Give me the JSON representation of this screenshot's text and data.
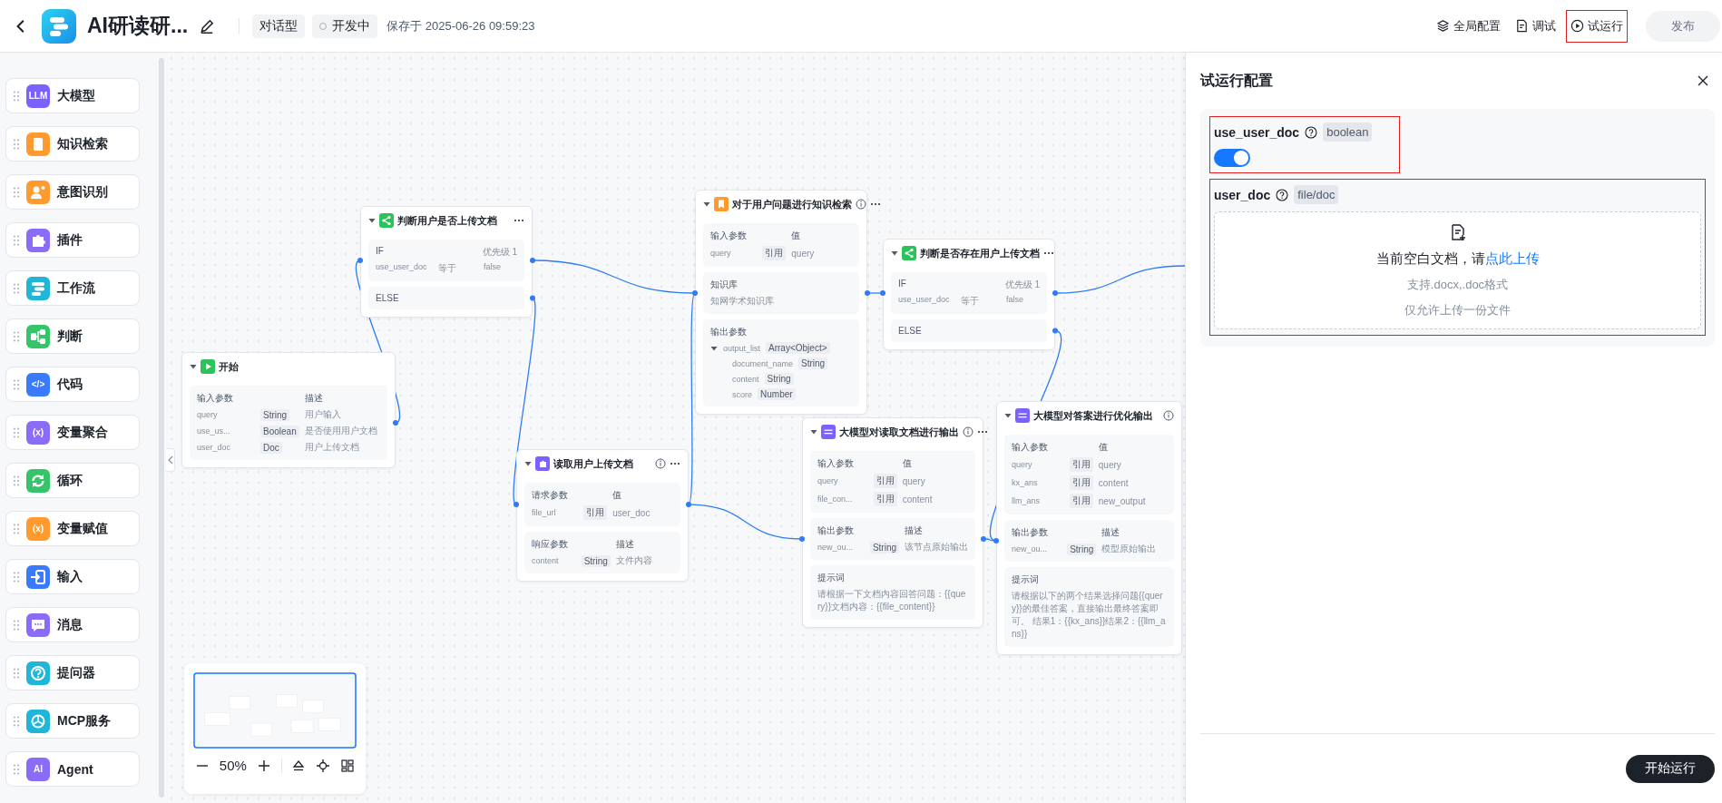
{
  "header": {
    "title": "AI研读研...",
    "mode_tag": "对话型",
    "status": "开发中",
    "saved": "保存于 2025-06-26 09:59:23",
    "actions": [
      {
        "label": "全局配置",
        "kind": "layers",
        "highlighted": false
      },
      {
        "label": "调试",
        "kind": "doc",
        "highlighted": false
      },
      {
        "label": "试运行",
        "kind": "play",
        "highlighted": true
      }
    ],
    "publish": {
      "label": "发布",
      "disabled": true
    }
  },
  "palette": [
    {
      "label": "大模型",
      "kind": "text",
      "icon_text": "LLM",
      "color": "#7b61ff"
    },
    {
      "label": "知识检索",
      "kind": "book",
      "color": "#ff9a2e"
    },
    {
      "label": "意图识别",
      "kind": "person",
      "color": "#ff9a2e"
    },
    {
      "label": "插件",
      "kind": "puzzle",
      "color": "#8b6cf6"
    },
    {
      "label": "工作流",
      "kind": "flow",
      "color": "#1fb6d8"
    },
    {
      "label": "判断",
      "kind": "branch",
      "color": "#35c46a"
    },
    {
      "label": "代码",
      "kind": "text",
      "icon_text": "</>",
      "color": "#3a7afe"
    },
    {
      "label": "变量聚合",
      "kind": "text",
      "icon_text": "(x)",
      "color": "#8b6cf6"
    },
    {
      "label": "循环",
      "kind": "loop",
      "color": "#35c46a"
    },
    {
      "label": "变量赋值",
      "kind": "text",
      "icon_text": "(x)",
      "color": "#ff9a2e"
    },
    {
      "label": "输入",
      "kind": "input",
      "color": "#3a7afe"
    },
    {
      "label": "消息",
      "kind": "message",
      "color": "#8b6cf6"
    },
    {
      "label": "提问器",
      "kind": "question",
      "color": "#1fb6d8"
    },
    {
      "label": "MCP服务",
      "kind": "mcp",
      "color": "#1fb6d8"
    },
    {
      "label": "Agent",
      "kind": "text",
      "icon_text": "AI",
      "color": "#8b6cf6"
    }
  ],
  "nodes": [
    {
      "title": "开始",
      "kind": "start",
      "expanded": true,
      "info": false,
      "menu": false,
      "sections": [
        {
          "kind": "params",
          "headers": [
            "输入参数",
            "描述"
          ],
          "rows": [
            {
              "name": "query",
              "tag": "String",
              "value": "用户输入"
            },
            {
              "name": "use_us...",
              "tag": "Boolean",
              "value": "是否使用用户文档"
            },
            {
              "name": "user_doc",
              "tag": "Doc",
              "value": "用户上传文档"
            }
          ]
        }
      ]
    },
    {
      "title": "判断用户是否上传文档",
      "kind": "branch",
      "expanded": true,
      "info": false,
      "menu": true,
      "sections": [
        {
          "kind": "condition",
          "label": "IF",
          "priority": "优先级 1",
          "rows": [
            {
              "name": "use_user_doc",
              "op": "等于",
              "value": "false"
            }
          ]
        },
        {
          "kind": "else",
          "label": "ELSE"
        }
      ]
    },
    {
      "title": "对于用户问题进行知识检索",
      "kind": "knowledge",
      "expanded": true,
      "info": true,
      "menu": true,
      "sections": [
        {
          "kind": "params",
          "headers": [
            "输入参数",
            "值"
          ],
          "rows": [
            {
              "name": "query",
              "tag": "引用",
              "value": "query"
            }
          ]
        },
        {
          "kind": "text",
          "title": "知识库",
          "text": "知网学术知识库"
        },
        {
          "kind": "tree",
          "title": "输出参数",
          "rows": [
            {
              "name": "output_list",
              "tag": "Array<Object>",
              "expanded": true,
              "children": [
                {
                  "name": "document_name",
                  "tag": "String"
                },
                {
                  "name": "content",
                  "tag": "String"
                },
                {
                  "name": "score",
                  "tag": "Number"
                }
              ]
            }
          ]
        }
      ]
    },
    {
      "title": "读取用户上传文档",
      "kind": "plugin",
      "expanded": true,
      "info": true,
      "menu": true,
      "sections": [
        {
          "kind": "params",
          "headers": [
            "请求参数",
            "值"
          ],
          "rows": [
            {
              "name": "file_url",
              "tag": "引用",
              "value": "user_doc"
            }
          ]
        },
        {
          "kind": "params",
          "headers": [
            "响应参数",
            "描述"
          ],
          "rows": [
            {
              "name": "content",
              "tag": "String",
              "value": "文件内容"
            }
          ]
        }
      ]
    },
    {
      "title": "判断是否存在用户上传文档",
      "kind": "branch",
      "expanded": true,
      "info": false,
      "menu": true,
      "sections": [
        {
          "kind": "condition",
          "label": "IF",
          "priority": "优先级 1",
          "rows": [
            {
              "name": "use_user_doc",
              "op": "等于",
              "value": "false"
            }
          ]
        },
        {
          "kind": "else",
          "label": "ELSE"
        }
      ]
    },
    {
      "title": "大模型对读取文档进行输出",
      "kind": "llm",
      "expanded": true,
      "info": true,
      "menu": true,
      "sections": [
        {
          "kind": "params",
          "headers": [
            "输入参数",
            "值"
          ],
          "rows": [
            {
              "name": "query",
              "tag": "引用",
              "value": "query"
            },
            {
              "name": "file_con...",
              "tag": "引用",
              "value": "content"
            }
          ]
        },
        {
          "kind": "params",
          "headers": [
            "输出参数",
            "描述"
          ],
          "rows": [
            {
              "name": "new_ou...",
              "tag": "String",
              "value": "该节点原始输出"
            }
          ]
        },
        {
          "kind": "text",
          "title": "提示词",
          "text": "请根据一下文档内容回答问题：{{query}}文档内容：{{file_content}}"
        }
      ]
    },
    {
      "title": "大模型对答案进行优化输出",
      "kind": "llm",
      "expanded": true,
      "info": true,
      "menu": false,
      "sections": [
        {
          "kind": "params",
          "headers": [
            "输入参数",
            "值"
          ],
          "rows": [
            {
              "name": "query",
              "tag": "引用",
              "value": "query"
            },
            {
              "name": "kx_ans",
              "tag": "引用",
              "value": "content"
            },
            {
              "name": "llm_ans",
              "tag": "引用",
              "value": "new_output"
            }
          ]
        },
        {
          "kind": "params",
          "headers": [
            "输出参数",
            "描述"
          ],
          "rows": [
            {
              "name": "new_ou...",
              "tag": "String",
              "value": "模型原始输出"
            }
          ]
        },
        {
          "kind": "text",
          "title": "提示词",
          "text": "请根据以下的两个结果选择问题{{query}}的最佳答案，直接输出最终答案即可。 结果1：{{kx_ans}}结果2：{{llm_ans}}"
        }
      ]
    }
  ],
  "minimap": {
    "zoom": "50%"
  },
  "panel": {
    "title": "试运行配置",
    "params": [
      {
        "kind": "toggle",
        "name": "use_user_doc",
        "type": "boolean",
        "on": true,
        "highlighted": true
      },
      {
        "kind": "file",
        "name": "user_doc",
        "type": "file/doc",
        "highlighted": true,
        "prompt": "当前空白文档，请",
        "link": "点此上传",
        "hints": [
          "支持.docx,.doc格式",
          "仅允许上传一份文件"
        ]
      }
    ],
    "run_button": "开始运行"
  }
}
